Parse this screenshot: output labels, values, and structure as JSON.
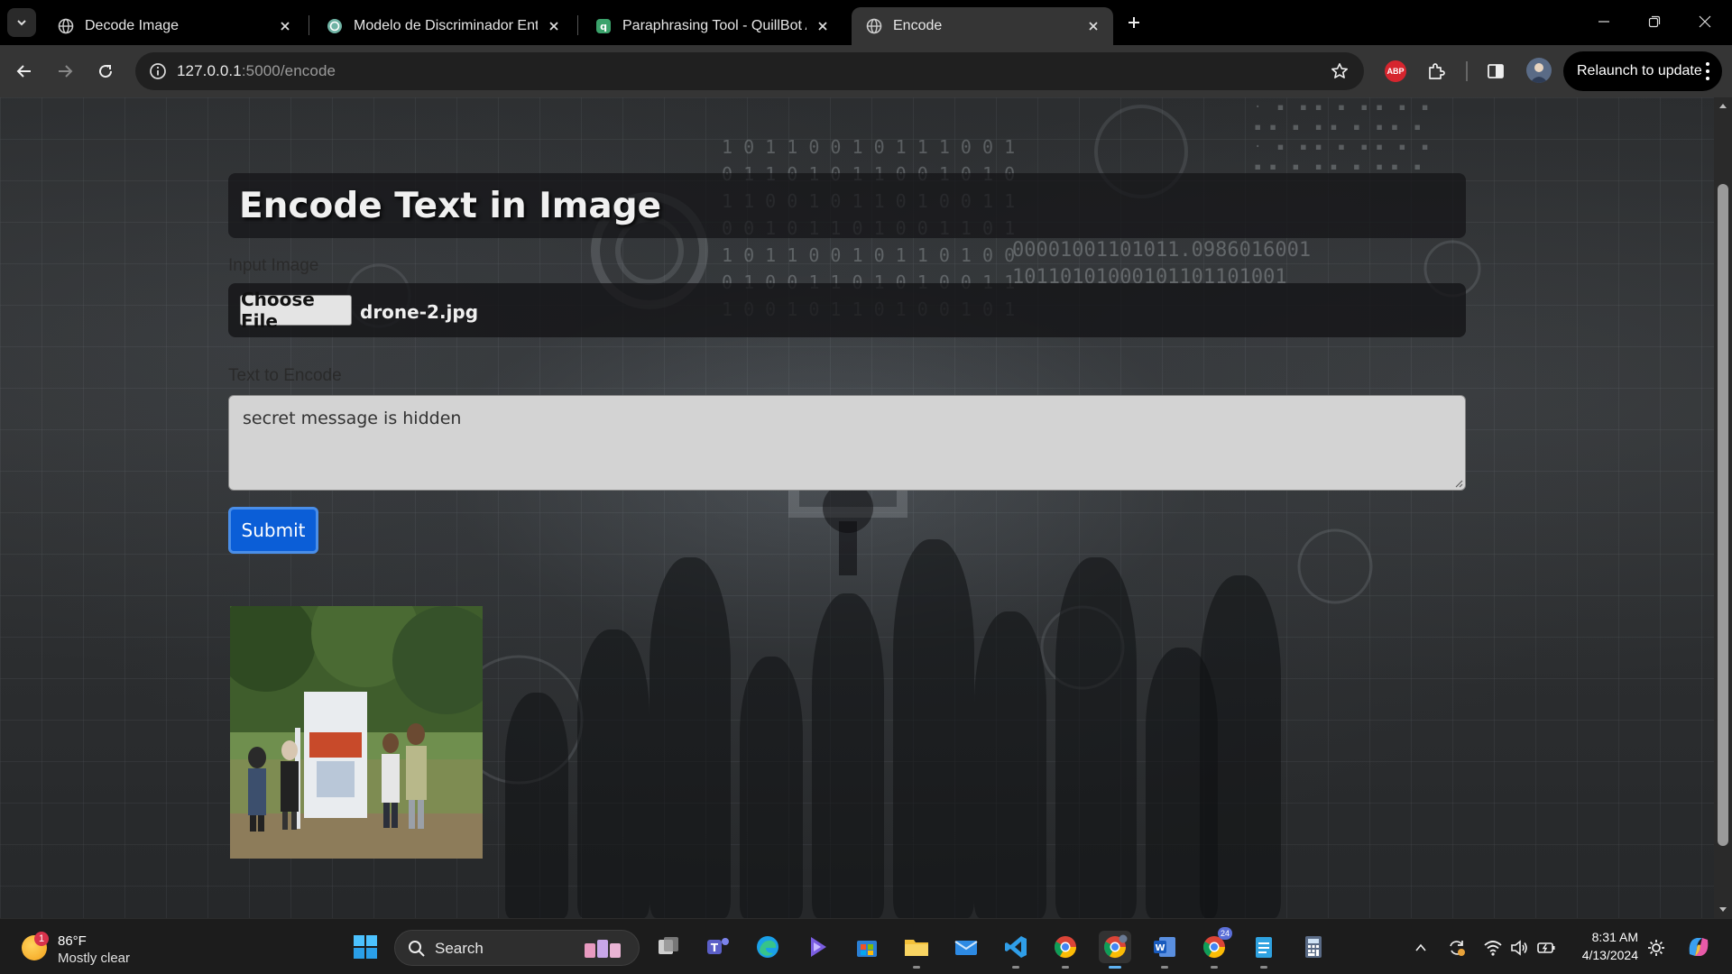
{
  "browser": {
    "tabs": [
      {
        "title": "Decode Image",
        "favicon": "globe-icon",
        "active": false
      },
      {
        "title": "Modelo de Discriminador Entre",
        "favicon": "openai-icon",
        "active": false
      },
      {
        "title": "Paraphrasing Tool - QuillBot AI",
        "favicon": "quillbot-icon",
        "active": false
      },
      {
        "title": "Encode",
        "favicon": "globe-icon",
        "active": true
      }
    ],
    "url_host": "127.0.0.1",
    "url_path": ":5000/encode",
    "abp_label": "ABP",
    "relaunch_label": "Relaunch to update"
  },
  "page": {
    "heading": "Encode Text in Image",
    "input_image_label": "Input Image",
    "choose_file_label": "Choose File",
    "file_name": "drone-2.jpg",
    "text_label": "Text to Encode",
    "text_value": "secret message is hidden",
    "submit_label": "Submit",
    "image_alt": "Encoded image preview"
  },
  "taskbar": {
    "weather_temp": "86°F",
    "weather_desc": "Mostly clear",
    "weather_badge": "1",
    "search_label": "Search",
    "chrome_badge": "24",
    "time": "8:31 AM",
    "date": "4/13/2024"
  },
  "colors": {
    "submit": "#0b5ed7",
    "tab_active": "#353535",
    "accent": "#5fb2f2"
  }
}
